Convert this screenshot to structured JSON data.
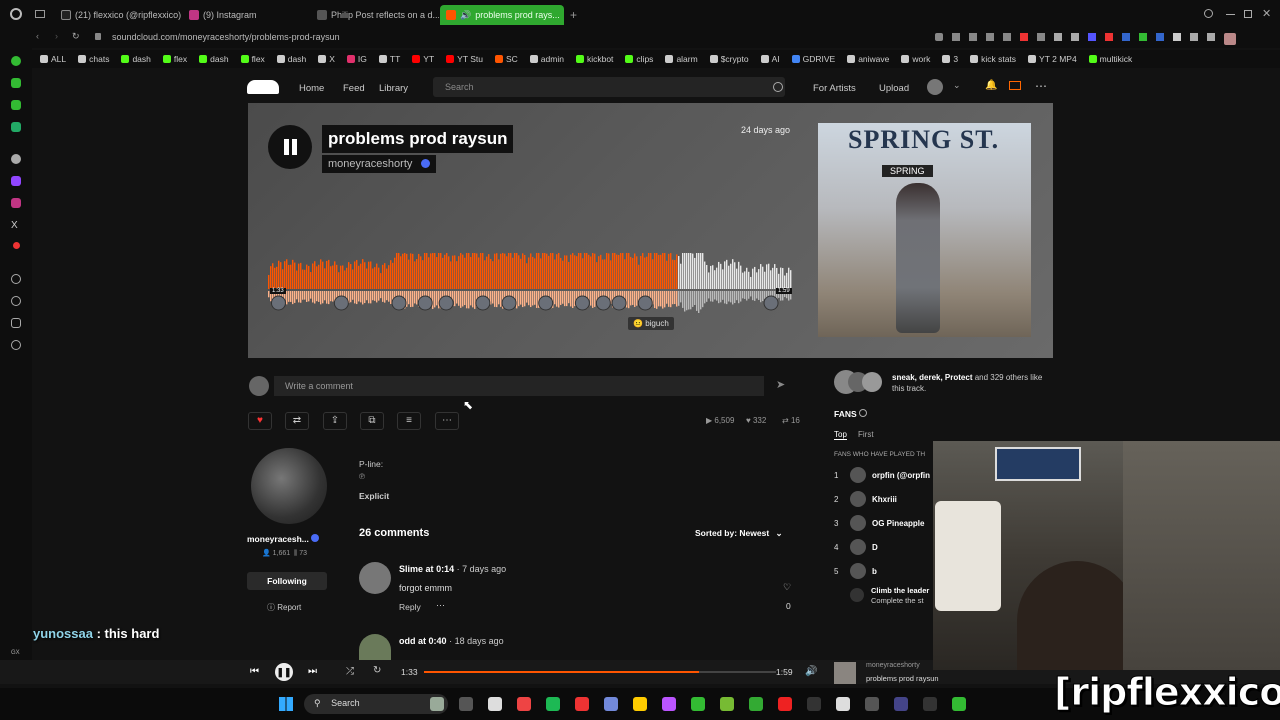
{
  "browser": {
    "tabs": [
      {
        "label": "(21) flexxico (@ripflexxico)",
        "color": "#222"
      },
      {
        "label": "(9) Instagram",
        "color": "#c13584"
      },
      {
        "label": "Philip Post reflects on a d...",
        "color": "#333"
      },
      {
        "label": "problems prod rays...",
        "color": "#ff5500"
      }
    ],
    "url": "soundcloud.com/moneyraceshorty/problems-prod-raysun",
    "bookmarks": [
      "ALL",
      "chats",
      "dash",
      "flex",
      "dash",
      "flex",
      "dash",
      "X",
      "IG",
      "TT",
      "YT",
      "YT Stu",
      "SC",
      "admin",
      "kickbot",
      "clips",
      "alarm",
      "$crypto",
      "AI",
      "GDRIVE",
      "aniwave",
      "work",
      "3",
      "kick stats",
      "YT 2 MP4",
      "multikick"
    ],
    "bookmark_colors": [
      "#ccc",
      "#ccc",
      "#53fc18",
      "#53fc18",
      "#53fc18",
      "#53fc18",
      "#ccc",
      "#ccc",
      "#e1306c",
      "#ccc",
      "#f00",
      "#f00",
      "#ff5500",
      "#ccc",
      "#53fc18",
      "#53fc18",
      "#ccc",
      "#ccc",
      "#ccc",
      "#4285f4",
      "#ccc",
      "#ccc",
      "#ccc",
      "#ccc",
      "#ccc",
      "#53fc18"
    ]
  },
  "header": {
    "nav": [
      "Home",
      "Feed",
      "Library"
    ],
    "search_placeholder": "Search",
    "for_artists": "For Artists",
    "upload": "Upload"
  },
  "track": {
    "title": "problems prod raysun",
    "artist": "moneyraceshorty",
    "posted": "24 days ago",
    "time_left": "1:33",
    "time_right": "1:59",
    "commenter": "biguch",
    "art_sign": "SPRING ST.",
    "art_sub": "SPRING"
  },
  "comment_box": {
    "placeholder": "Write a comment"
  },
  "stats": {
    "plays": "6,509",
    "likes": "332",
    "reposts": "16"
  },
  "artist_panel": {
    "name": "moneyracesh...",
    "followers": "1,661",
    "tracks": "73",
    "following_label": "Following",
    "report_label": "Report"
  },
  "meta": {
    "pline": "P-line:",
    "pline_value": "℗",
    "explicit": "Explicit"
  },
  "comments": {
    "count_label": "26 comments",
    "sort_label": "Sorted by: Newest",
    "items": [
      {
        "user": "Slime",
        "at": "at",
        "time": "0:14",
        "ago": "· 7 days ago",
        "text": "forgot emmm",
        "reply": "Reply",
        "likes": "0"
      },
      {
        "user": "odd",
        "at": "at",
        "time": "0:40",
        "ago": "· 18 days ago"
      }
    ]
  },
  "likes_panel": {
    "names": "sneak, derek, Protect",
    "rest": " and 329 others like this track."
  },
  "fans": {
    "title": "FANS",
    "tabs": [
      "Top",
      "First"
    ],
    "subtitle": "FANS WHO HAVE PLAYED TH",
    "list": [
      {
        "rank": "1",
        "name": "orpfin (@orpfin"
      },
      {
        "rank": "2",
        "name": "Khxriii"
      },
      {
        "rank": "3",
        "name": "OG Pineapple"
      },
      {
        "rank": "4",
        "name": "D"
      },
      {
        "rank": "5",
        "name": "b"
      }
    ],
    "promo_title": "Climb the leader",
    "promo_sub": "Complete the st"
  },
  "player": {
    "current": "1:33",
    "duration": "1:59",
    "progress": 0.78,
    "mini_artist": "moneyraceshorty",
    "mini_title": "problems prod raysun"
  },
  "taskbar": {
    "search": "Search"
  },
  "chat": {
    "user": "yunossaa",
    "message": " : this hard"
  },
  "watermark": "[ripflexxico]"
}
